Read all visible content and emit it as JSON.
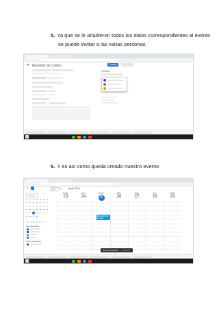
{
  "steps": [
    {
      "number": "5.",
      "line1": "Ya que se le añadieron todos los datos correspondientes al evento",
      "line2": "se puede invitar a las varias personas."
    },
    {
      "number": "6.",
      "line1": "Y es así como queda creado nuestro evento"
    }
  ],
  "screenshot1": {
    "event_title": "REUNIÓN DE CURSO",
    "save_label": "Guardar",
    "more_label": "Más acciones",
    "guests_heading": "Invitados",
    "suggestions": [
      "Organizadora",
      "Invitado",
      "Invitado",
      "Invitado"
    ]
  },
  "screenshot2": {
    "create_label": "Crear",
    "today_label": "Hoy",
    "month_label": "Junio 2019",
    "day_names": [
      "DOM.",
      "LUN.",
      "MAR.",
      "MIÉ.",
      "JUE.",
      "VIE.",
      "SÁB."
    ],
    "day_numbers": [
      "23",
      "24",
      "25",
      "26",
      "27",
      "28",
      "29"
    ],
    "today_index": 2,
    "event_text": "REUNIÓN DE CURSO",
    "snackbar_text": "Evento guardado",
    "snackbar_action": "Deshacer",
    "my_calendars_label": "Mis calendarios",
    "other_calendars_label": "Otros calendarios"
  },
  "colors": {
    "accent": "#1a73e8",
    "event": "#039be5",
    "taskbar": "#1c1c1c"
  }
}
